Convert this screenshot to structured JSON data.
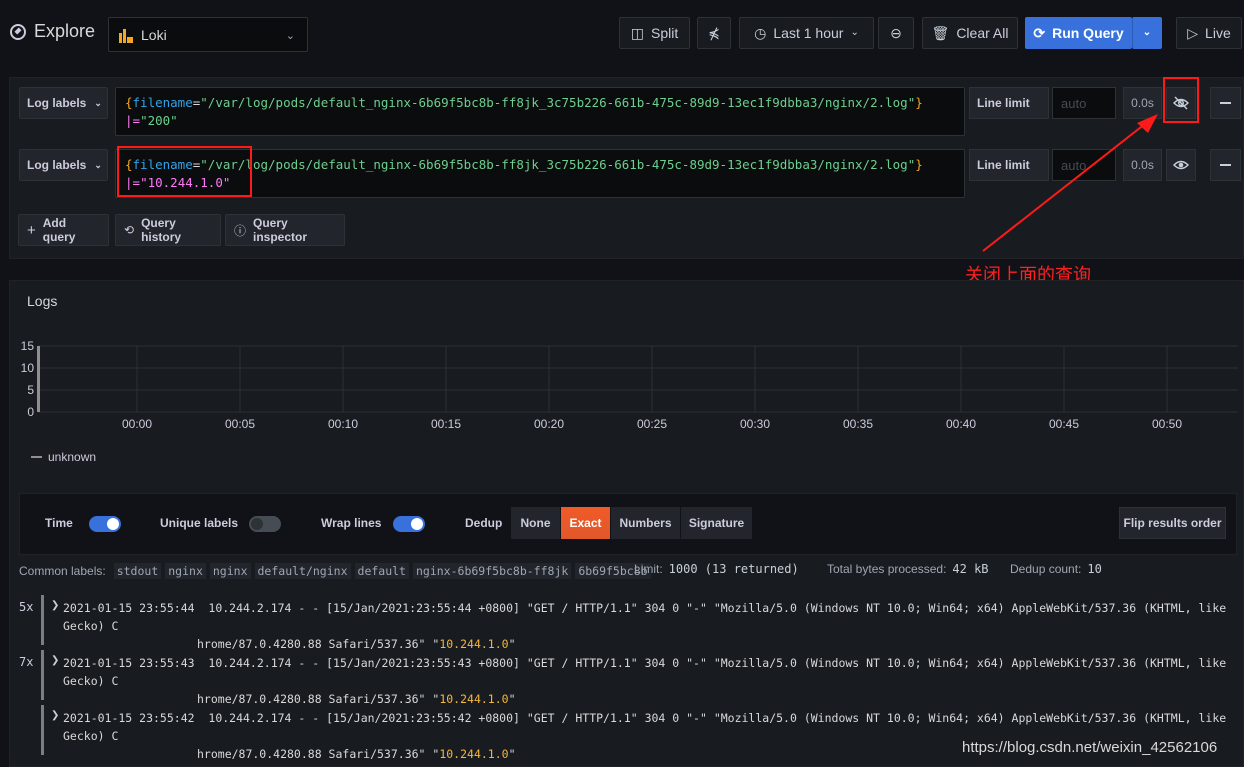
{
  "header": {
    "title": "Explore",
    "datasource": "Loki",
    "split_label": "Split",
    "time_range": "Last 1 hour",
    "clear_all_label": "Clear All",
    "run_query_label": "Run Query",
    "live_label": "Live"
  },
  "queries": [
    {
      "label_button": "Log labels",
      "key": "filename",
      "value": "\"/var/log/pods/default_nginx-6b69f5bc8b-ff8jk_3c75b226-661b-475c-89d9-13ec1f9dbba3/nginx/2.log\"",
      "operator": "|=",
      "filter": "\"200\"",
      "line_limit_label": "Line limit",
      "line_limit_placeholder": "auto",
      "duration": "0.0s"
    },
    {
      "label_button": "Log labels",
      "key": "filename",
      "value": "\"/var/log/pods/default_nginx-6b69f5bc8b-ff8jk_3c75b226-661b-475c-89d9-13ec1f9dbba3/nginx/2.log\"",
      "operator": "|=",
      "filter": "\"10.244.1.0\"",
      "line_limit_label": "Line limit",
      "line_limit_placeholder": "auto",
      "duration": "0.0s"
    }
  ],
  "query_actions": {
    "add_query": "Add query",
    "query_history": "Query history",
    "query_inspector": "Query inspector"
  },
  "annotation": {
    "text": "关闭上面的查询",
    "color": "#ff2020"
  },
  "logs_panel": {
    "title": "Logs",
    "legend": "unknown"
  },
  "chart_data": {
    "type": "bar",
    "title": "",
    "xlabel": "",
    "ylabel": "",
    "ylim": [
      0,
      15
    ],
    "y_ticks": [
      "15",
      "10",
      "5",
      "0"
    ],
    "categories": [
      "00:00",
      "00:05",
      "00:10",
      "00:15",
      "00:20",
      "00:25",
      "00:30",
      "00:35",
      "00:40",
      "00:45",
      "00:50"
    ],
    "series": [
      {
        "name": "unknown",
        "values": [
          0,
          0,
          0,
          0,
          0,
          0,
          0,
          0,
          0,
          0,
          0
        ]
      }
    ],
    "grid": true
  },
  "options": {
    "time_label": "Time",
    "time_on": true,
    "unique_labels_label": "Unique labels",
    "unique_labels_on": false,
    "wrap_lines_label": "Wrap lines",
    "wrap_lines_on": true,
    "dedup_label": "Dedup",
    "dedup_options": [
      "None",
      "Exact",
      "Numbers",
      "Signature"
    ],
    "dedup_selected": "Exact",
    "flip_label": "Flip results order"
  },
  "common_labels": {
    "label": "Common labels:",
    "tags": [
      "stdout",
      "nginx",
      "nginx",
      "default/nginx",
      "default",
      "nginx-6b69f5bc8b-ff8jk",
      "6b69f5bc8b"
    ]
  },
  "stats": {
    "limit_label": "Limit:",
    "limit_value": "1000 (13 returned)",
    "bytes_label": "Total bytes processed:",
    "bytes_value": "42 kB",
    "dedup_count_label": "Dedup count:",
    "dedup_count_value": "10"
  },
  "log_rows": [
    {
      "count": "5x",
      "line1": "2021-01-15 23:55:44  10.244.2.174 - - [15/Jan/2021:23:55:44 +0800] \"GET / HTTP/1.1\" 304 0 \"-\" \"Mozilla/5.0 (Windows NT 10.0; Win64; x64) AppleWebKit/537.36 (KHTML, like Gecko) C",
      "line2_pre": "hrome/87.0.4280.88 Safari/537.36\" \"",
      "highlight": "10.244.1.0",
      "line2_post": "\""
    },
    {
      "count": "7x",
      "line1": "2021-01-15 23:55:43  10.244.2.174 - - [15/Jan/2021:23:55:43 +0800] \"GET / HTTP/1.1\" 304 0 \"-\" \"Mozilla/5.0 (Windows NT 10.0; Win64; x64) AppleWebKit/537.36 (KHTML, like Gecko) C",
      "line2_pre": "hrome/87.0.4280.88 Safari/537.36\" \"",
      "highlight": "10.244.1.0",
      "line2_post": "\""
    },
    {
      "count": "",
      "line1": "2021-01-15 23:55:42  10.244.2.174 - - [15/Jan/2021:23:55:42 +0800] \"GET / HTTP/1.1\" 304 0 \"-\" \"Mozilla/5.0 (Windows NT 10.0; Win64; x64) AppleWebKit/537.36 (KHTML, like Gecko) C",
      "line2_pre": "hrome/87.0.4280.88 Safari/537.36\" \"",
      "highlight": "10.244.1.0",
      "line2_post": "\""
    }
  ],
  "watermark": "https://blog.csdn.net/weixin_42562106"
}
